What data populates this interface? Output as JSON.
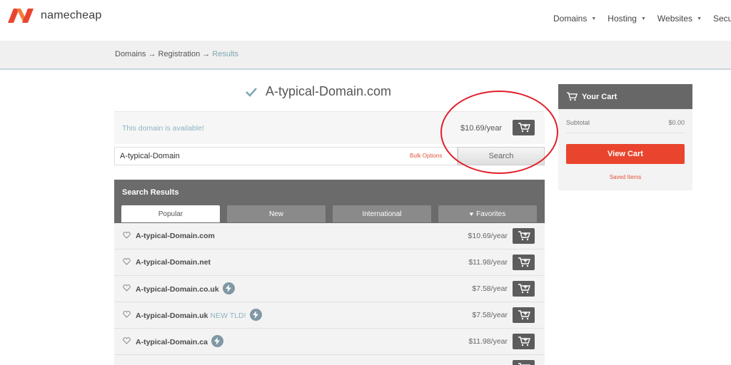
{
  "brand": {
    "name": "namecheap",
    "accent": "#e9452e"
  },
  "nav": {
    "items": [
      "Domains",
      "Hosting",
      "Websites",
      "Secur"
    ]
  },
  "breadcrumb": {
    "step1": "Domains",
    "sep": " → ",
    "step2": "Registration",
    "step3": "Results"
  },
  "domain": {
    "title": "A-typical-Domain.com",
    "available_text": "This domain is available!",
    "price": "$10.69/year"
  },
  "search": {
    "value": "A-typical-Domain",
    "bulk_label": "Bulk Options",
    "button_label": "Search"
  },
  "results": {
    "heading": "Search Results",
    "tabs": [
      "Popular",
      "New",
      "International",
      "Favorites"
    ],
    "rows": [
      {
        "name": "A-typical-Domain.com",
        "price": "$10.69/year",
        "tag": "",
        "bolt": false
      },
      {
        "name": "A-typical-Domain.net",
        "price": "$11.98/year",
        "tag": "",
        "bolt": false
      },
      {
        "name": "A-typical-Domain.co.uk",
        "price": "$7.58/year",
        "tag": "",
        "bolt": true
      },
      {
        "name": "A-typical-Domain.uk",
        "price": "$7.58/year",
        "tag": "NEW TLD!",
        "bolt": true
      },
      {
        "name": "A-typical-Domain.ca",
        "price": "$11.98/year",
        "tag": "",
        "bolt": true
      }
    ]
  },
  "cart": {
    "title": "Your Cart",
    "subtotal_label": "Subtotal",
    "subtotal_value": "$0.00",
    "view_cart_label": "View Cart",
    "saved_items_label": "Saved Items"
  }
}
